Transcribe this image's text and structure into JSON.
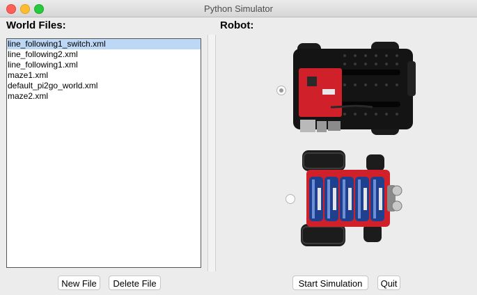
{
  "window": {
    "title": "Python Simulator"
  },
  "world_files": {
    "heading": "World Files:",
    "items": [
      "line_following1_switch.xml",
      "line_following2.xml",
      "line_following1.xml",
      "maze1.xml",
      "default_pi2go_world.xml",
      "maze2.xml"
    ],
    "selected_index": 0
  },
  "robot": {
    "heading": "Robot:",
    "options": [
      {
        "name": "robot-option-top-view",
        "selected": true
      },
      {
        "name": "robot-option-battery-view",
        "selected": false
      }
    ]
  },
  "buttons": {
    "new_file": "New File",
    "delete_file": "Delete File",
    "start_simulation": "Start Simulation",
    "quit": "Quit"
  },
  "colors": {
    "selection": "#bcd8f5",
    "board_red": "#d0202a",
    "chassis": "#141414",
    "battery_blue": "#1f3f8f"
  },
  "icons": [
    "close-icon",
    "minimize-icon",
    "maximize-icon"
  ]
}
